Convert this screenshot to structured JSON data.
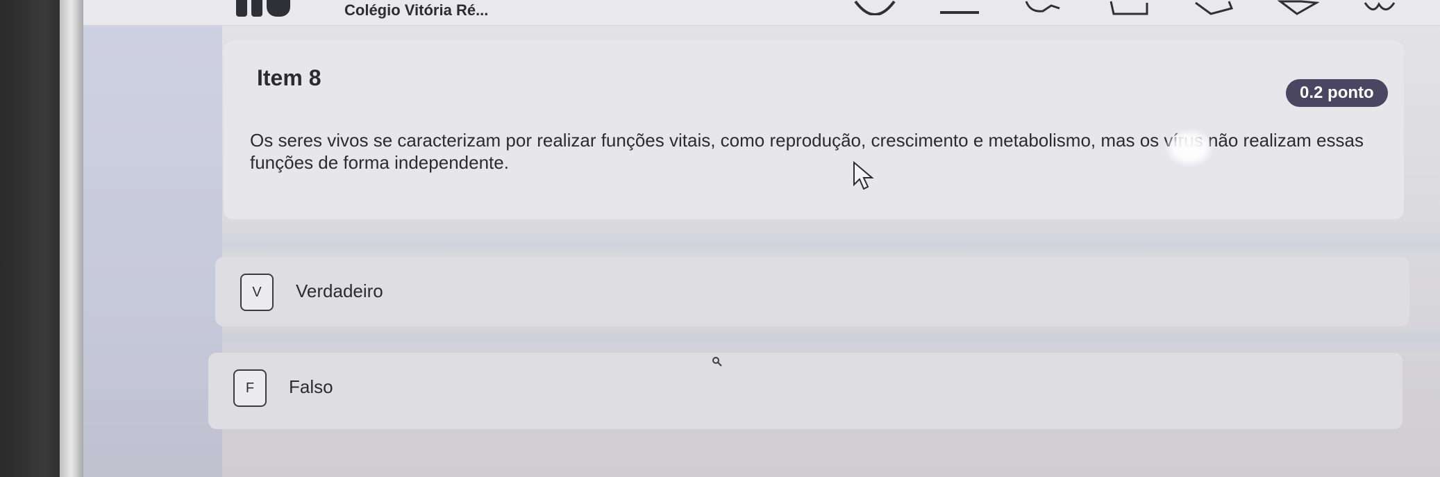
{
  "header": {
    "school_name": "Colégio Vitória Ré..."
  },
  "question": {
    "title": "Item 8",
    "points": "0.2 ponto",
    "statement": "Os seres vivos se caracterizam por realizar funções vitais, como reprodução, crescimento e metabolismo, mas os vírus não realizam essas funções de forma independente."
  },
  "options": [
    {
      "letter": "V",
      "label": "Verdadeiro"
    },
    {
      "letter": "F",
      "label": "Falso"
    }
  ],
  "icons": {
    "cursor": "arrow-pointer-icon",
    "toolbar": [
      "tool-icon-1",
      "tool-icon-2",
      "tool-icon-3",
      "tool-icon-4",
      "tool-icon-5",
      "tool-icon-6",
      "tool-icon-7"
    ]
  },
  "colors": {
    "badge_bg": "#4a4560",
    "sidebar": "#c9ccdc",
    "card_bg": "#e6e6eb"
  }
}
